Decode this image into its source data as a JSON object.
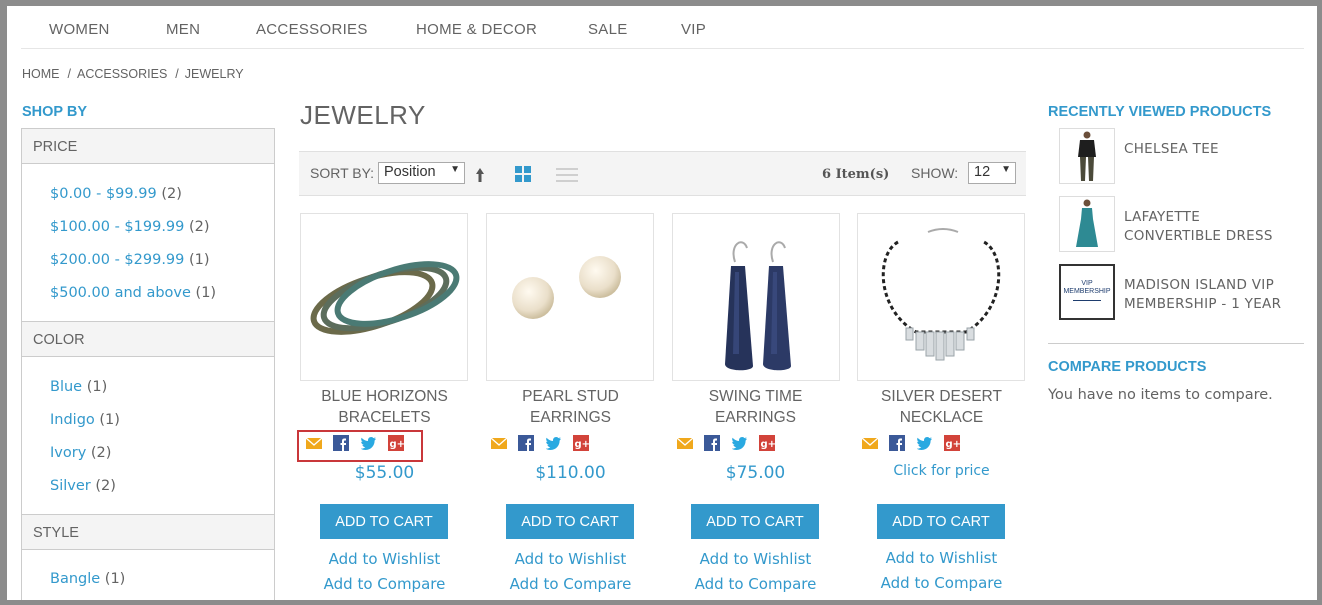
{
  "nav": [
    "WOMEN",
    "MEN",
    "ACCESSORIES",
    "HOME & DECOR",
    "SALE",
    "VIP"
  ],
  "breadcrumb": [
    "HOME",
    "ACCESSORIES",
    "JEWELRY"
  ],
  "breadcrumb_sep": "/",
  "shop_by": "SHOP BY",
  "facets": {
    "price": {
      "title": "PRICE",
      "options": [
        {
          "label": "$0.00 - $99.99",
          "count": "(2)"
        },
        {
          "label": "$100.00 - $199.99",
          "count": "(2)"
        },
        {
          "label": "$200.00 - $299.99",
          "count": "(1)"
        },
        {
          "label": "$500.00 and above",
          "count": "(1)"
        }
      ]
    },
    "color": {
      "title": "COLOR",
      "options": [
        {
          "label": "Blue",
          "count": "(1)"
        },
        {
          "label": "Indigo",
          "count": "(1)"
        },
        {
          "label": "Ivory",
          "count": "(2)"
        },
        {
          "label": "Silver",
          "count": "(2)"
        }
      ]
    },
    "style": {
      "title": "STYLE",
      "options": [
        {
          "label": "Bangle",
          "count": "(1)"
        }
      ]
    }
  },
  "page_title": "JEWELRY",
  "toolbar": {
    "sort_label": "SORT BY:",
    "sort_value": "Position",
    "item_count": "6 Item(s)",
    "show_label": "SHOW:",
    "show_value": "12"
  },
  "products": [
    {
      "name_line1": "BLUE HORIZONS",
      "name_line2": "BRACELETS",
      "price": "$55.00",
      "cart": "ADD TO CART",
      "wishlist": "Add to Wishlist",
      "compare": "Add to Compare"
    },
    {
      "name_line1": "PEARL STUD",
      "name_line2": "EARRINGS",
      "price": "$110.00",
      "cart": "ADD TO CART",
      "wishlist": "Add to Wishlist",
      "compare": "Add to Compare"
    },
    {
      "name_line1": "SWING TIME",
      "name_line2": "EARRINGS",
      "price": "$75.00",
      "cart": "ADD TO CART",
      "wishlist": "Add to Wishlist",
      "compare": "Add to Compare"
    },
    {
      "name_line1": "SILVER DESERT",
      "name_line2": "NECKLACE",
      "price_link": "Click for price",
      "cart": "ADD TO CART",
      "wishlist": "Add to Wishlist",
      "compare": "Add to Compare"
    }
  ],
  "recently_viewed": {
    "title": "RECENTLY VIEWED PRODUCTS",
    "items": [
      {
        "line1": "CHELSEA TEE",
        "line2": ""
      },
      {
        "line1": "LAFAYETTE",
        "line2": "CONVERTIBLE DRESS"
      },
      {
        "line1": "MADISON ISLAND VIP",
        "line2": "MEMBERSHIP - 1 YEAR"
      }
    ],
    "vip_logo_text": "VIP MEMBERSHIP"
  },
  "compare": {
    "title": "COMPARE PRODUCTS",
    "empty_text": "You have no items to compare."
  },
  "colors": {
    "accent": "#3399cc",
    "text": "#636363",
    "highlight": "#c9373a",
    "email_icon": "#f0a81c",
    "facebook_icon": "#3b5998",
    "twitter_icon": "#29a9e1",
    "gplus_icon": "#d2433a"
  },
  "icons": [
    "email-icon",
    "facebook-icon",
    "twitter-icon",
    "google-plus-icon",
    "sort-direction-icon",
    "grid-view-icon",
    "list-view-icon"
  ]
}
